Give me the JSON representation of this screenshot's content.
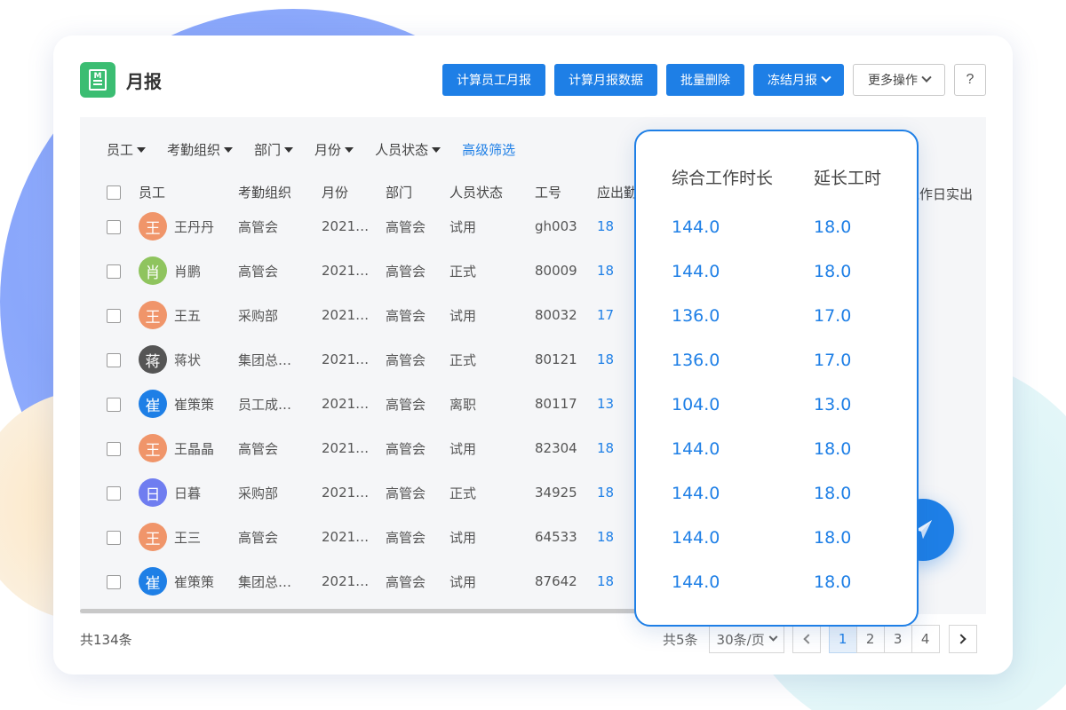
{
  "page": {
    "title": "月报"
  },
  "colors": {
    "primary": "#1e7fe6",
    "logo": "#3bbd72"
  },
  "toolbar": {
    "calc_employee": "计算员工月报",
    "calc_data": "计算月报数据",
    "batch_delete": "批量删除",
    "freeze": "冻结月报",
    "more": "更多操作",
    "help": "?"
  },
  "filters": {
    "employee": "员工",
    "org": "考勤组织",
    "dept": "部门",
    "month": "月份",
    "status": "人员状态",
    "advanced": "高级筛选"
  },
  "table": {
    "headers": {
      "employee": "员工",
      "org": "考勤组织",
      "month": "月份",
      "dept": "部门",
      "status": "人员状态",
      "no": "工号",
      "due": "应出勤",
      "right": "工作日实出"
    },
    "rows": [
      {
        "avatar": "王",
        "avatar_color": "#f0956a",
        "name": "王丹丹",
        "org": "高管会",
        "month": "2021…",
        "dept": "高管会",
        "status": "试用",
        "no": "gh003",
        "due": "18"
      },
      {
        "avatar": "肖",
        "avatar_color": "#8fc45e",
        "name": "肖鹏",
        "org": "高管会",
        "month": "2021…",
        "dept": "高管会",
        "status": "正式",
        "no": "80009",
        "due": "18"
      },
      {
        "avatar": "王",
        "avatar_color": "#f0956a",
        "name": "王五",
        "org": "采购部",
        "month": "2021…",
        "dept": "高管会",
        "status": "试用",
        "no": "80032",
        "due": "17"
      },
      {
        "avatar": "蒋",
        "avatar_color": "#555555",
        "name": "蒋状",
        "org": "集团总…",
        "month": "2021…",
        "dept": "高管会",
        "status": "正式",
        "no": "80121",
        "due": "18"
      },
      {
        "avatar": "崔",
        "avatar_color": "#1e7fe6",
        "name": "崔策策",
        "org": "员工成…",
        "month": "2021…",
        "dept": "高管会",
        "status": "离职",
        "no": "80117",
        "due": "13"
      },
      {
        "avatar": "王",
        "avatar_color": "#f0956a",
        "name": "王晶晶",
        "org": "高管会",
        "month": "2021…",
        "dept": "高管会",
        "status": "试用",
        "no": "82304",
        "due": "18"
      },
      {
        "avatar": "日",
        "avatar_color": "#6f7df0",
        "name": "日暮",
        "org": "采购部",
        "month": "2021…",
        "dept": "高管会",
        "status": "正式",
        "no": "34925",
        "due": "18"
      },
      {
        "avatar": "王",
        "avatar_color": "#f0956a",
        "name": "王三",
        "org": "高管会",
        "month": "2021…",
        "dept": "高管会",
        "status": "试用",
        "no": "64533",
        "due": "18"
      },
      {
        "avatar": "崔",
        "avatar_color": "#1e7fe6",
        "name": "崔策策",
        "org": "集团总…",
        "month": "2021…",
        "dept": "高管会",
        "status": "试用",
        "no": "87642",
        "due": "18"
      }
    ]
  },
  "popup": {
    "col1": "综合工作时长",
    "col2": "延长工时",
    "rows": [
      {
        "v1": "144.0",
        "v2": "18.0"
      },
      {
        "v1": "144.0",
        "v2": "18.0"
      },
      {
        "v1": "136.0",
        "v2": "17.0"
      },
      {
        "v1": "136.0",
        "v2": "17.0"
      },
      {
        "v1": "104.0",
        "v2": "13.0"
      },
      {
        "v1": "144.0",
        "v2": "18.0"
      },
      {
        "v1": "144.0",
        "v2": "18.0"
      },
      {
        "v1": "144.0",
        "v2": "18.0"
      },
      {
        "v1": "144.0",
        "v2": "18.0"
      }
    ]
  },
  "footer": {
    "total": "共134条",
    "pages_total": "共5条",
    "page_size": "30条/页",
    "pages": [
      "1",
      "2",
      "3",
      "4"
    ],
    "current_page": "1"
  },
  "icons": {
    "logo": "report-m-icon",
    "fab": "paper-plane-icon"
  }
}
